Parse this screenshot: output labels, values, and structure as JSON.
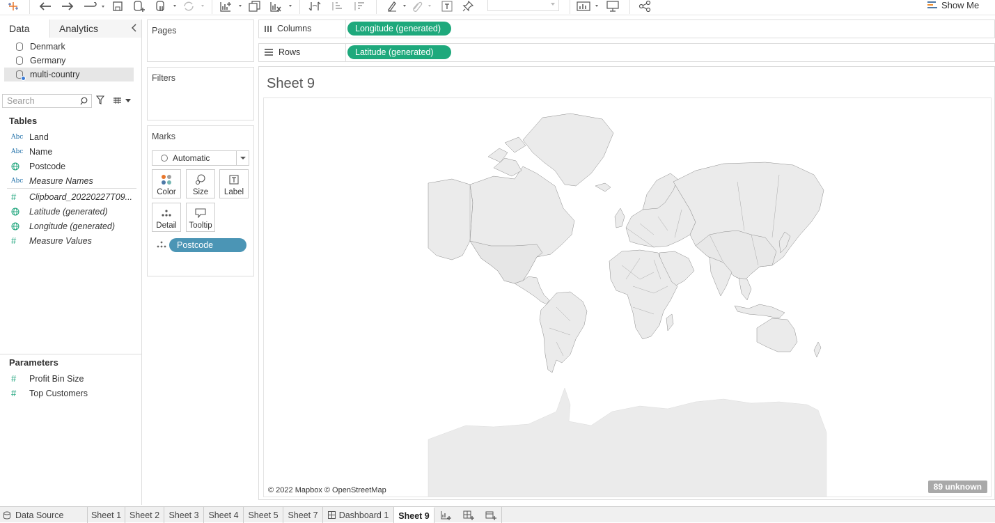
{
  "toolbar": {
    "show_me_label": "Show Me"
  },
  "data_pane": {
    "tabs": [
      "Data",
      "Analytics"
    ],
    "data_sources": [
      {
        "name": "Denmark",
        "selected": false
      },
      {
        "name": "Germany",
        "selected": false
      },
      {
        "name": "multi-country",
        "selected": true
      }
    ],
    "search_placeholder": "Search",
    "tables_title": "Tables",
    "fields": [
      {
        "type": "Abc",
        "name": "Land",
        "italic": false
      },
      {
        "type": "Abc",
        "name": "Name",
        "italic": false
      },
      {
        "type": "globe",
        "name": "Postcode",
        "italic": false
      },
      {
        "type": "Abc",
        "name": "Measure Names",
        "italic": true
      },
      {
        "type": "#",
        "name": "Clipboard_20220227T09...",
        "italic": true
      },
      {
        "type": "globe",
        "name": "Latitude (generated)",
        "italic": true
      },
      {
        "type": "globe",
        "name": "Longitude (generated)",
        "italic": true
      },
      {
        "type": "#",
        "name": "Measure Values",
        "italic": true
      }
    ],
    "parameters_title": "Parameters",
    "parameters": [
      {
        "type": "#",
        "name": "Profit Bin Size"
      },
      {
        "type": "#",
        "name": "Top Customers"
      }
    ]
  },
  "cards": {
    "pages_title": "Pages",
    "filters_title": "Filters",
    "marks_title": "Marks",
    "mark_type": "Automatic",
    "mark_buttons": [
      "Color",
      "Size",
      "Label",
      "Detail",
      "Tooltip"
    ],
    "mark_pill": "Postcode"
  },
  "shelves": {
    "columns_label": "Columns",
    "columns_pill": "Longitude (generated)",
    "rows_label": "Rows",
    "rows_pill": "Latitude (generated)"
  },
  "view": {
    "sheet_title": "Sheet 9",
    "attribution": "© 2022 Mapbox © OpenStreetMap",
    "unknown_badge": "89 unknown"
  },
  "bottom_tabs": {
    "data_source": "Data Source",
    "sheets": [
      "Sheet 1",
      "Sheet 2",
      "Sheet 3",
      "Sheet 4",
      "Sheet 5",
      "Sheet 7",
      "Dashboard 1",
      "Sheet 9"
    ],
    "active": "Sheet 9"
  },
  "colors": {
    "pill_green": "#1ea97c",
    "pill_blue": "#4b95b5",
    "land": "#ebebeb",
    "border": "#777777"
  }
}
